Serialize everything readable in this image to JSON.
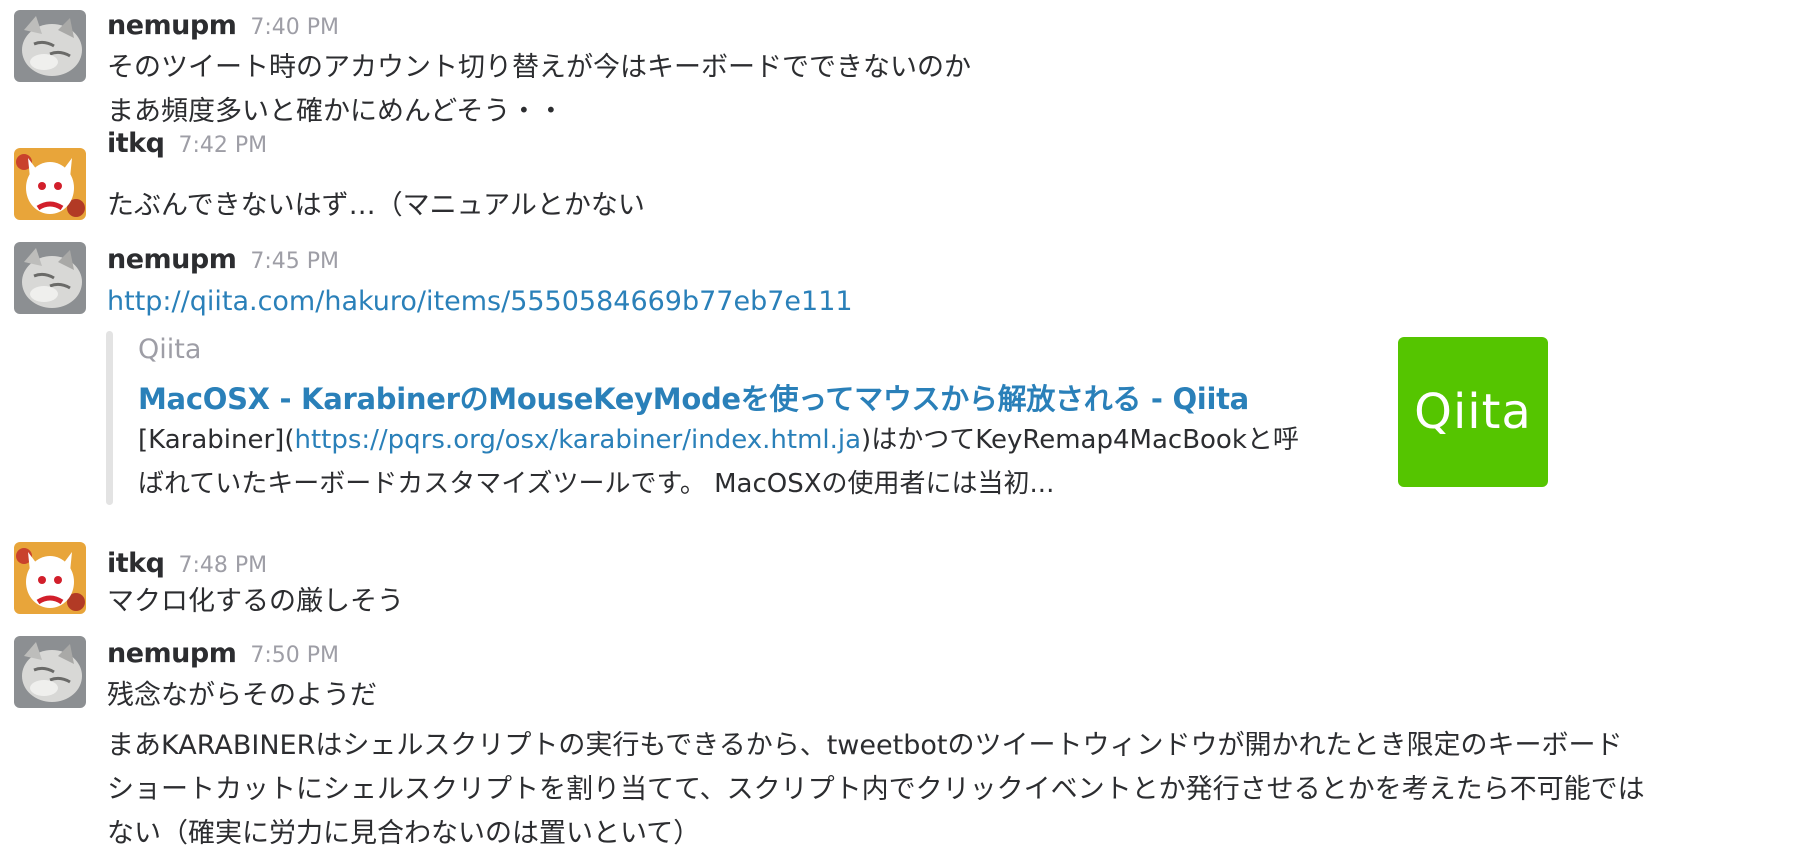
{
  "messages": [
    {
      "user": "nemupm",
      "time": "7:40 PM",
      "avatar": "cat-avatar",
      "lines": [
        "そのツイート時のアカウント切り替えが今はキーボードでできないのか",
        "まあ頻度多いと確かにめんどそう・・"
      ]
    },
    {
      "user": "itkq",
      "time": "7:42 PM",
      "avatar": "kyubey-avatar",
      "lines": [
        "たぶんできないはず…（マニュアルとかない"
      ]
    },
    {
      "user": "nemupm",
      "time": "7:45 PM",
      "avatar": "cat-avatar",
      "link": "http://qiita.com/hakuro/items/5550584669b77eb7e111",
      "attachment": {
        "service": "Qiita",
        "title": "MacOSX - KarabinerのMouseKeyModeを使ってマウスから解放される - Qiita",
        "text_prefix": "[Karabiner](",
        "text_link": "https://pqrs.org/osx/karabiner/index.html.ja",
        "text_suffix": ")はかつてKeyRemap4MacBookと呼",
        "text_line2": "ばれていたキーボードカスタマイズツールです。 MacOSXの使用者には当初...",
        "thumb_label": "Qiita"
      }
    },
    {
      "user": "itkq",
      "time": "7:48 PM",
      "avatar": "kyubey-avatar",
      "lines": [
        "マクロ化するの厳しそう"
      ]
    },
    {
      "user": "nemupm",
      "time": "7:50 PM",
      "avatar": "cat-avatar",
      "lines": [
        "残念ながらそのようだ",
        "まあKARABINERはシェルスクリプトの実行もできるから、tweetbotのツイートウィンドウが開かれたとき限定のキーボード",
        "ショートカットにシェルスクリプトを割り当てて、スクリプト内でクリックイベントとか発行させるとかを考えたら不可能では",
        "ない（確実に労力に見合わないのは置いといて）"
      ]
    }
  ],
  "colors": {
    "link": "#2a80b9",
    "text": "#2c2d30",
    "meta": "#9e9ea6",
    "qiita": "#55c500"
  }
}
